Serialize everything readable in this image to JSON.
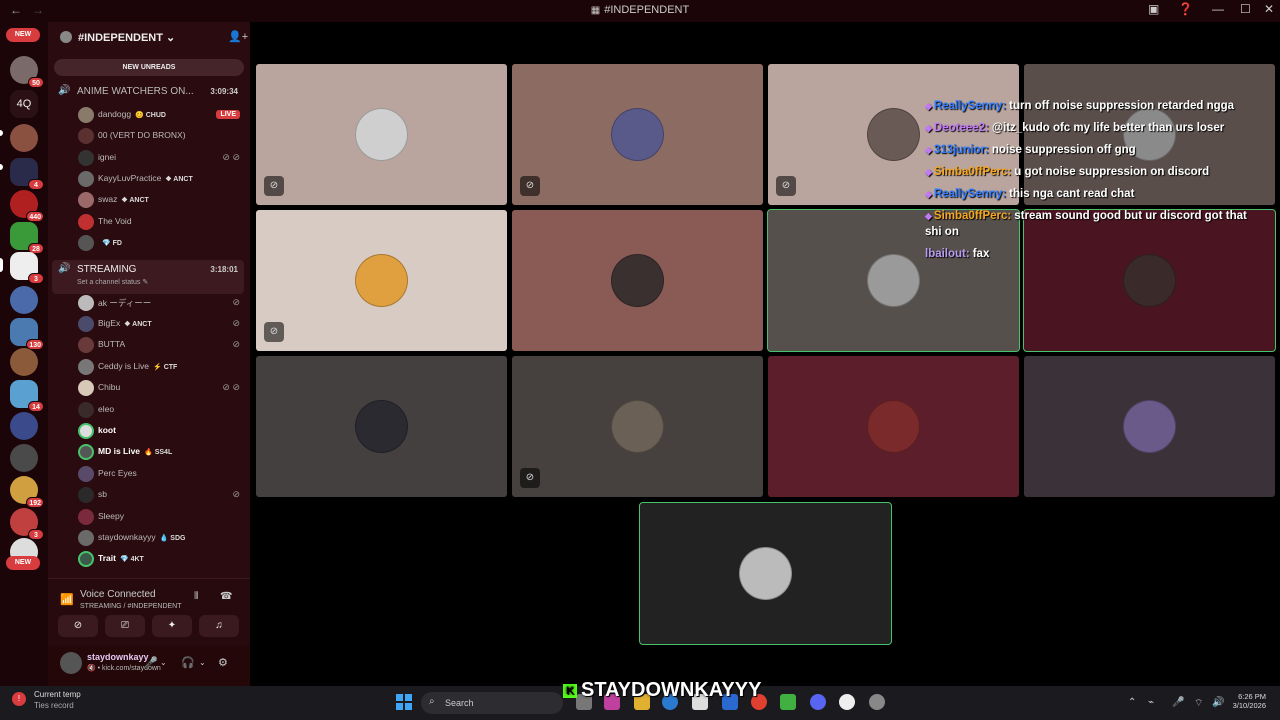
{
  "window": {
    "title": "#INDEPENDENT"
  },
  "server_list": {
    "new_top": "NEW",
    "new_bottom": "NEW",
    "text_server": "4Q",
    "badges": [
      "50",
      "4",
      "440",
      "28",
      "3",
      "130",
      "14",
      "192",
      "3"
    ]
  },
  "guild": {
    "name": "#INDEPENDENT",
    "new_unreads": "NEW UNREADS"
  },
  "voice_channels": [
    {
      "name": "ANIME WATCHERS ON...",
      "time": "3:09:34",
      "users": [
        {
          "name": "dandogg",
          "tag": "😊 CHUD",
          "live": "LIVE"
        },
        {
          "name": "00 (VERT DO BRONX)"
        },
        {
          "name": "ignei"
        },
        {
          "name": "KayyLuvPractice",
          "tag": "❖ ANCT"
        },
        {
          "name": "swaz",
          "tag": "❖ ANCT"
        },
        {
          "name": "The Void"
        },
        {
          "name": "",
          "tag": "💎 FD"
        }
      ]
    },
    {
      "name": "STREAMING",
      "status": "Set a channel status ✎",
      "time": "3:18:01",
      "users": [
        {
          "name": "ak ーディーー"
        },
        {
          "name": "BigEx",
          "tag": "❖ ANCT"
        },
        {
          "name": "BUTTA"
        },
        {
          "name": "Ceddy is Live",
          "tag": "⚡ CTF"
        },
        {
          "name": "Chibu"
        },
        {
          "name": "eleo"
        },
        {
          "name": "koot"
        },
        {
          "name": "MD is Live",
          "tag": "🔥 SS4L"
        },
        {
          "name": "Perc Eyes"
        },
        {
          "name": "sb"
        },
        {
          "name": "Sleepy"
        },
        {
          "name": "staydownkayyy",
          "tag": "💧 SDG"
        },
        {
          "name": "Trait",
          "tag": "💎 4KT"
        }
      ]
    }
  ],
  "voice_panel": {
    "title": "Voice Connected",
    "subtitle": "STREAMING / #INDEPENDENT"
  },
  "user_panel": {
    "name": "staydownkayy",
    "sub": "🔇 • kick.com/staydown"
  },
  "chat": [
    {
      "user": "ReallySenny:",
      "msg": "turn off noise suppression retarded ngga",
      "color": "#2e7bff"
    },
    {
      "user": "Deoteee2:",
      "msg": "@itz_kudo ofc my life better than urs loser",
      "color": "#c17af5"
    },
    {
      "user": "313junior:",
      "msg": "noise suppression off gng",
      "color": "#2e7bff"
    },
    {
      "user": "Simba0ffPerc:",
      "msg": "u got noise suppression on discord",
      "color": "#f5a623"
    },
    {
      "user": "ReallySenny:",
      "msg": "this nga cant read chat",
      "color": "#2e7bff"
    },
    {
      "user": "Simba0ffPerc:",
      "msg": "stream sound good but ur discord got that shi on",
      "color": "#f5a623"
    },
    {
      "user": "lbailout:",
      "msg": "fax",
      "color": "#b89cf0"
    }
  ],
  "tiles": [
    {
      "bg": "#b9a59d",
      "avatar": "#cfcfd0",
      "muted": true,
      "speaking": false
    },
    {
      "bg": "#8c6c62",
      "avatar": "#5a5a8a",
      "muted": true,
      "speaking": false
    },
    {
      "bg": "#b9a59d",
      "avatar": "#6a5a55",
      "muted": true,
      "speaking": false
    },
    {
      "bg": "#5a4e4a",
      "avatar": "#8a8a8a",
      "muted": false,
      "speaking": false
    },
    {
      "bg": "#d8cbc4",
      "avatar": "#e0a040",
      "muted": true,
      "speaking": false
    },
    {
      "bg": "#8a5a55",
      "avatar": "#3a3030",
      "muted": false,
      "speaking": false
    },
    {
      "bg": "#56504c",
      "avatar": "#9a9a9a",
      "muted": false,
      "speaking": true
    },
    {
      "bg": "#4a1520",
      "avatar": "#3a2a2a",
      "muted": false,
      "speaking": true
    },
    {
      "bg": "#444040",
      "avatar": "#2a2a30",
      "muted": false,
      "speaking": false
    },
    {
      "bg": "#46403e",
      "avatar": "#6a6055",
      "muted": true,
      "speaking": false
    },
    {
      "bg": "#5c1e2a",
      "avatar": "#7a2a2a",
      "muted": false,
      "speaking": false
    },
    {
      "bg": "#3a3238",
      "avatar": "#6a5a8a",
      "muted": false,
      "speaking": false
    },
    {
      "bg": "#222222",
      "avatar": "#bbbbbb",
      "muted": false,
      "speaking": true
    }
  ],
  "taskbar": {
    "weather_title": "Current temp",
    "weather_sub": "Ties record",
    "search": "Search",
    "time": "6:26 PM",
    "date": "3/10/2026"
  },
  "watermark": "STAYDOWNKAYYY",
  "watermark_logo": "K"
}
